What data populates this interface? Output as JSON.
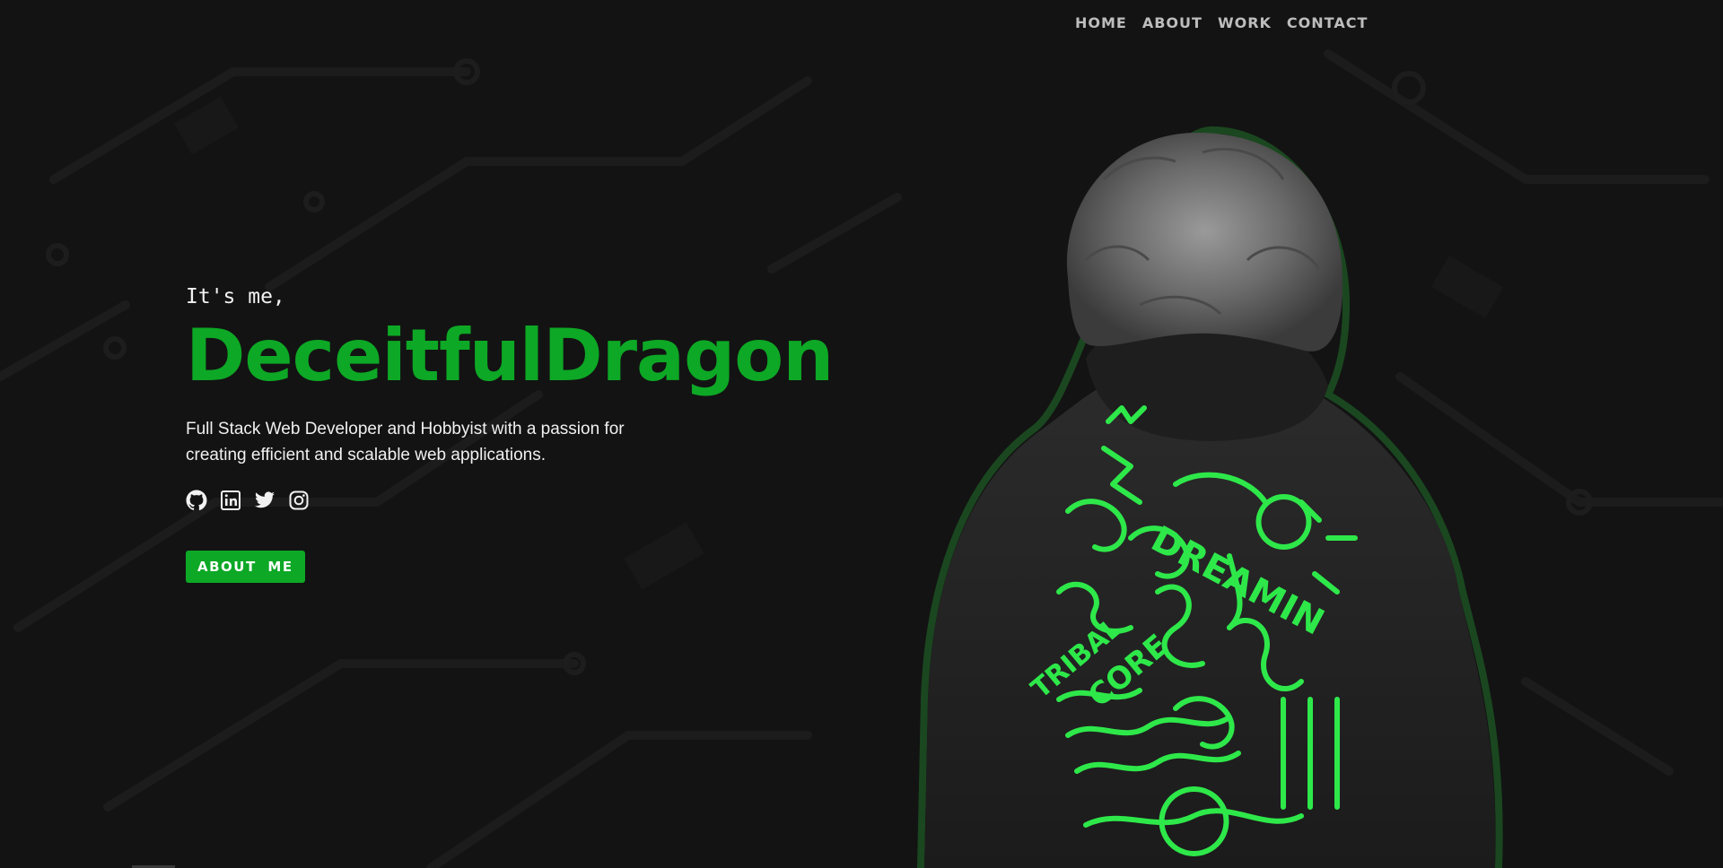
{
  "nav": {
    "items": [
      {
        "label": "HOME"
      },
      {
        "label": "ABOUT"
      },
      {
        "label": "WORK"
      },
      {
        "label": "CONTACT"
      }
    ]
  },
  "hero": {
    "greeting": "It's me,",
    "name": "DeceitfulDragon",
    "tagline": "Full Stack Web Developer and Hobbyist with a passion for creating efficient and scalable web applications.",
    "socials": [
      {
        "icon": "github-icon"
      },
      {
        "icon": "linkedin-icon"
      },
      {
        "icon": "twitter-icon"
      },
      {
        "icon": "instagram-icon"
      }
    ],
    "button_label": "ABOUT ME"
  },
  "portrait": {
    "hoodie_print": [
      "DREAMIN",
      "TRIBAL",
      "CORE"
    ]
  },
  "colors": {
    "background": "#131313",
    "accent": "#0da825",
    "print_green": "#2ee84a",
    "text": "#f0f0f0",
    "nav_text": "#bdbdbd"
  }
}
